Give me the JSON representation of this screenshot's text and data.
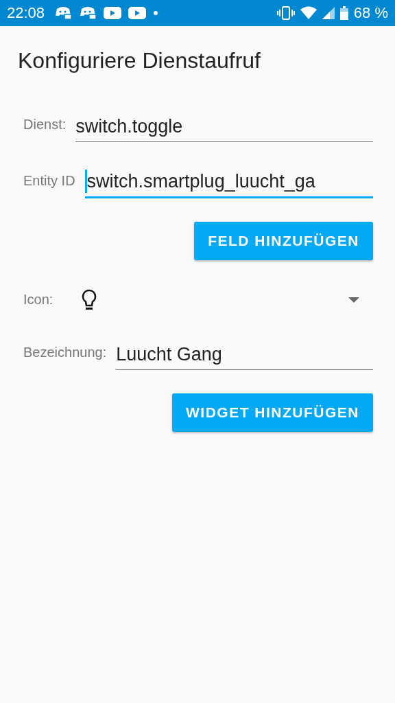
{
  "status_bar": {
    "time": "22:08",
    "notifications": [
      {
        "kind": "chat"
      },
      {
        "kind": "chat"
      },
      {
        "kind": "video"
      },
      {
        "kind": "video"
      },
      {
        "kind": "dot"
      }
    ],
    "battery": "68 %"
  },
  "title": "Konfiguriere Dienstaufruf",
  "rows": [
    {
      "kind": "text",
      "label": "Dienst:",
      "value": "switch.toggle",
      "focused": false
    },
    {
      "kind": "text",
      "label": "Entity ID",
      "value": "switch.smartplug_luucht_ga",
      "focused": true
    },
    {
      "kind": "button",
      "label": "FELD HINZUFÜGEN"
    },
    {
      "kind": "icon",
      "label": "Icon:"
    },
    {
      "kind": "text",
      "label": "Bezeichnung:",
      "value": "Luucht Gang",
      "focused": false
    },
    {
      "kind": "button",
      "label": "WIDGET HINZUFÜGEN"
    }
  ]
}
